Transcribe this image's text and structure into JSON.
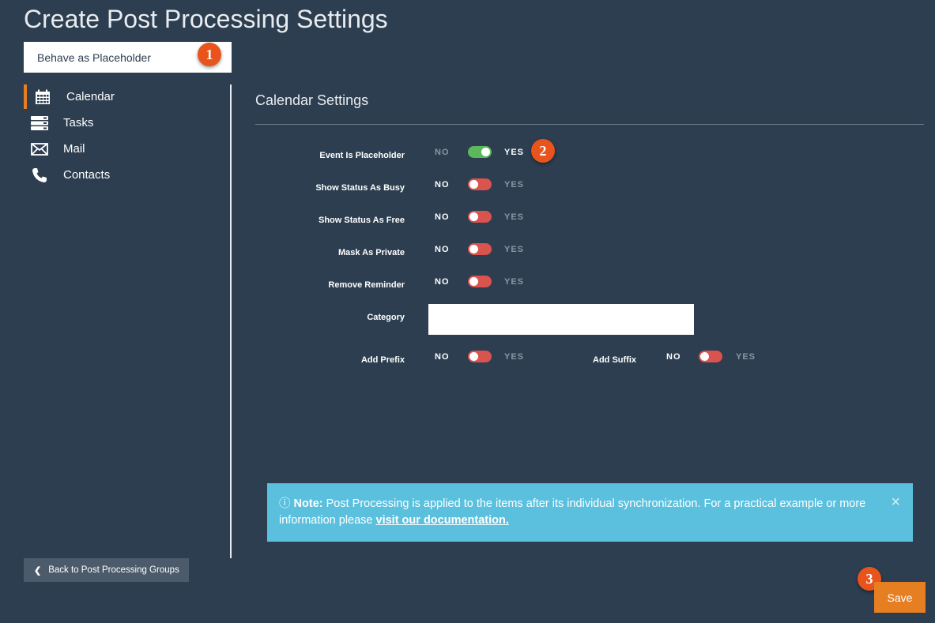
{
  "page": {
    "title": "Create Post Processing Settings",
    "name_value": "Behave as Placeholder"
  },
  "badges": [
    "1",
    "2",
    "3"
  ],
  "sidebar": {
    "items": [
      {
        "label": "Calendar",
        "icon": "calendar-icon",
        "active": true
      },
      {
        "label": "Tasks",
        "icon": "tasks-icon",
        "active": false
      },
      {
        "label": "Mail",
        "icon": "mail-icon",
        "active": false
      },
      {
        "label": "Contacts",
        "icon": "phone-icon",
        "active": false
      }
    ]
  },
  "settings": {
    "title": "Calendar Settings",
    "no_label": "NO",
    "yes_label": "YES",
    "rows": [
      {
        "label": "Event Is Placeholder",
        "value": true
      },
      {
        "label": "Show Status As Busy",
        "value": false
      },
      {
        "label": "Show Status As Free",
        "value": false
      },
      {
        "label": "Mask As Private",
        "value": false
      },
      {
        "label": "Remove Reminder",
        "value": false
      }
    ],
    "category_label": "Category",
    "category_value": "",
    "add_prefix": {
      "label": "Add Prefix",
      "value": false
    },
    "add_suffix": {
      "label": "Add Suffix",
      "value": false
    }
  },
  "note": {
    "prefix": "Note:",
    "text": " Post Processing is applied to the items after its individual synchronization. For a practical example or more information please ",
    "link": "visit our documentation.",
    "close": "×"
  },
  "buttons": {
    "back": "Back to Post Processing Groups",
    "save": "Save"
  },
  "colors": {
    "background": "#2c3e50",
    "accent": "#e67e22",
    "toggle_on": "#5cb85c",
    "toggle_off": "#d9534f",
    "note_bg": "#5bc0de",
    "badge": "#e8541c"
  }
}
